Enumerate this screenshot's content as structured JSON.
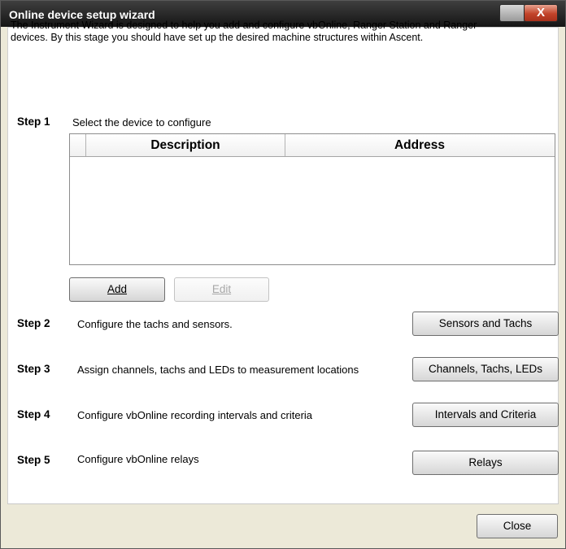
{
  "window": {
    "title": "Online device setup wizard",
    "close_glyph": "X"
  },
  "intro": "The Instrument Wizard is designed to help you add and configure vbOnline, Ranger Station and Ranger devices. By this stage you should have set up the desired machine structures within Ascent.",
  "steps": [
    {
      "label": "Step 1",
      "text": "Select the device to configure"
    },
    {
      "label": "Step 2",
      "text": "Configure the tachs and sensors.",
      "button": "Sensors and Tachs"
    },
    {
      "label": "Step 3",
      "text": "Assign channels, tachs and LEDs to measurement locations",
      "button": "Channels, Tachs, LEDs"
    },
    {
      "label": "Step 4",
      "text": "Configure vbOnline recording intervals and criteria",
      "button": "Intervals and Criteria"
    },
    {
      "label": "Step 5",
      "text": "Configure vbOnline relays",
      "button": "Relays"
    }
  ],
  "device_list": {
    "columns": [
      "Description",
      "Address"
    ],
    "rows": []
  },
  "buttons": {
    "add": "Add",
    "edit": "Edit",
    "close": "Close"
  }
}
